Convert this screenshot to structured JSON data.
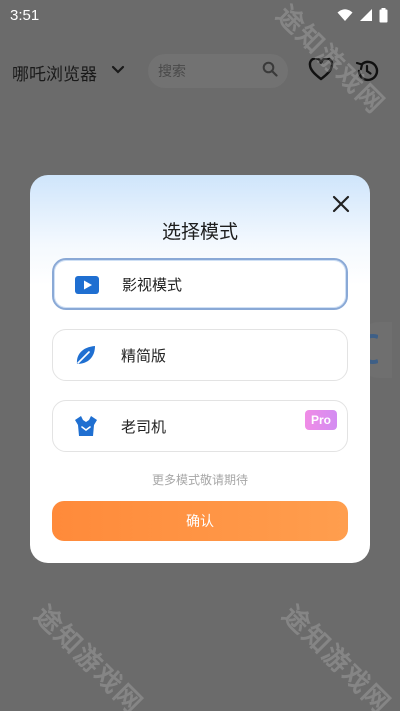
{
  "status_bar": {
    "time": "3:51",
    "icons": [
      "wifi-icon",
      "signal-icon",
      "battery-icon"
    ]
  },
  "app_bar": {
    "title": "哪吒浏览器",
    "search": {
      "placeholder": "搜索"
    },
    "actions": [
      "heart-icon",
      "history-icon"
    ]
  },
  "watermark": {
    "text": "途知游戏网"
  },
  "dialog": {
    "title": "选择模式",
    "options": [
      {
        "label": "影视模式",
        "icon": "video-play-icon",
        "selected": true
      },
      {
        "label": "精简版",
        "icon": "leaf-icon",
        "selected": false
      },
      {
        "label": "老司机",
        "icon": "driver-vest-icon",
        "selected": false,
        "badge": "Pro"
      }
    ],
    "hint": "更多模式敬请期待",
    "confirm_label": "确认"
  },
  "colors": {
    "accent_orange": "#ff8a3a",
    "accent_blue": "#1f6fd1",
    "selected_border": "#8aa9d6",
    "pro_badge": "#e28ce8",
    "overlay": "#6b6b6b"
  }
}
